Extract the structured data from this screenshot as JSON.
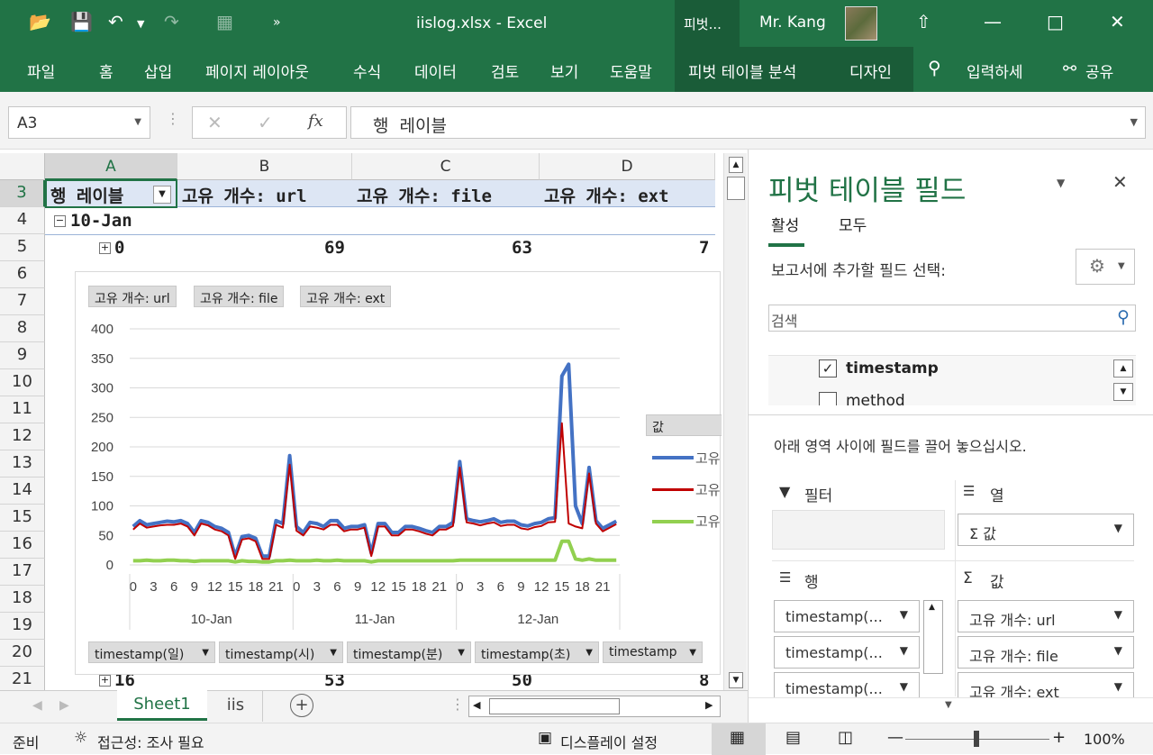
{
  "window": {
    "title": "iislog.xlsx  -  Excel",
    "context_tab": "피벗...",
    "user": "Mr. Kang"
  },
  "ribbon": {
    "tabs": [
      "파일",
      "홈",
      "삽입",
      "페이지 레이아웃",
      "수식",
      "데이터",
      "검토",
      "보기",
      "도움말",
      "피벗 테이블 분석",
      "디자인"
    ],
    "tell_me": "입력하세",
    "share": "공유"
  },
  "formula_bar": {
    "name_box": "A3",
    "content": "행  레이블",
    "fx": "fx"
  },
  "columns": [
    "A",
    "B",
    "C",
    "D"
  ],
  "rows": [
    "3",
    "4",
    "5",
    "6",
    "7",
    "8",
    "9",
    "10",
    "11",
    "12",
    "13",
    "14",
    "15",
    "16",
    "17",
    "18",
    "19",
    "20",
    "21"
  ],
  "cells": {
    "a3": "행 레이블",
    "b3": "고유 개수: url",
    "c3": "고유 개수: file",
    "d3": "고유 개수: ext",
    "a4": "10-Jan",
    "a5": "0",
    "b5": "69",
    "c5": "63",
    "d5": "7",
    "a21": "16",
    "b21": "53",
    "c21": "50",
    "d21": "8"
  },
  "chart": {
    "value_buttons": [
      "고유 개수: url",
      "고유 개수: file",
      "고유 개수: ext"
    ],
    "axis_buttons": [
      "timestamp(일)",
      "timestamp(시)",
      "timestamp(분)",
      "timestamp(초)",
      "timestamp"
    ],
    "legend_title": "값",
    "legend_items": [
      "고유",
      "고유",
      "고유"
    ],
    "groups": [
      "10-Jan",
      "11-Jan",
      "12-Jan"
    ],
    "hour_labels": [
      "0",
      "3",
      "6",
      "9",
      "12",
      "15",
      "18",
      "21"
    ]
  },
  "chart_data": {
    "type": "line",
    "ylim": [
      0,
      400
    ],
    "yticks": [
      0,
      50,
      100,
      150,
      200,
      250,
      300,
      350,
      400
    ],
    "x_count": 72,
    "colors": [
      "#4472c4",
      "#c00000",
      "#92d050"
    ],
    "series": [
      {
        "name": "고유 개수: url",
        "values": [
          65,
          75,
          68,
          70,
          72,
          74,
          73,
          75,
          70,
          55,
          75,
          72,
          65,
          62,
          55,
          15,
          48,
          50,
          45,
          15,
          15,
          75,
          70,
          185,
          65,
          55,
          72,
          70,
          65,
          75,
          75,
          62,
          65,
          65,
          68,
          20,
          70,
          70,
          55,
          55,
          65,
          65,
          62,
          58,
          55,
          65,
          65,
          72,
          175,
          78,
          75,
          73,
          75,
          78,
          72,
          74,
          74,
          68,
          66,
          70,
          72,
          78,
          80,
          320,
          340,
          100,
          70,
          165,
          75,
          62,
          68,
          74
        ]
      },
      {
        "name": "고유 개수: file",
        "values": [
          60,
          70,
          63,
          65,
          67,
          68,
          68,
          70,
          65,
          50,
          70,
          67,
          60,
          57,
          50,
          10,
          43,
          45,
          40,
          10,
          10,
          68,
          63,
          170,
          58,
          50,
          65,
          63,
          60,
          68,
          68,
          57,
          60,
          60,
          63,
          15,
          65,
          65,
          50,
          50,
          60,
          60,
          57,
          53,
          50,
          60,
          60,
          66,
          165,
          72,
          70,
          67,
          70,
          72,
          66,
          68,
          68,
          62,
          60,
          64,
          66,
          72,
          73,
          240,
          70,
          65,
          62,
          155,
          70,
          57,
          63,
          69
        ]
      },
      {
        "name": "고유 개수: ext",
        "values": [
          7,
          7,
          8,
          7,
          7,
          8,
          8,
          7,
          7,
          6,
          7,
          7,
          7,
          7,
          7,
          5,
          7,
          6,
          6,
          5,
          5,
          7,
          7,
          8,
          7,
          7,
          7,
          8,
          7,
          7,
          8,
          7,
          7,
          7,
          7,
          5,
          7,
          7,
          7,
          7,
          7,
          7,
          7,
          7,
          7,
          7,
          7,
          7,
          8,
          8,
          8,
          8,
          8,
          8,
          8,
          8,
          8,
          8,
          8,
          8,
          8,
          8,
          8,
          40,
          40,
          10,
          8,
          10,
          8,
          8,
          8,
          8
        ]
      }
    ]
  },
  "sheet_tabs": [
    "Sheet1",
    "iis"
  ],
  "status": {
    "ready": "준비",
    "accessibility": "접근성: 조사 필요",
    "display": "디스플레이 설정",
    "zoom": "100%"
  },
  "pivot_panel": {
    "title": "피벗 테이블 필드",
    "tabs": [
      "활성",
      "모두"
    ],
    "choose_label": "보고서에 추가할 필드 선택:",
    "search_placeholder": "검색",
    "fields": [
      {
        "name": "timestamp",
        "checked": true
      },
      {
        "name": "method",
        "checked": false
      }
    ],
    "drag_hint": "아래 영역 사이에 필드를 끌어 놓으십시오.",
    "areas": {
      "filter": "필터",
      "columns": "열",
      "rows": "행",
      "values": "값",
      "column_items": [
        "Σ 값"
      ],
      "row_items": [
        "timestamp(...",
        "timestamp(...",
        "timestamp(..."
      ],
      "value_items": [
        "고유 개수: url",
        "고유 개수: file",
        "고유 개수: ext"
      ]
    }
  }
}
